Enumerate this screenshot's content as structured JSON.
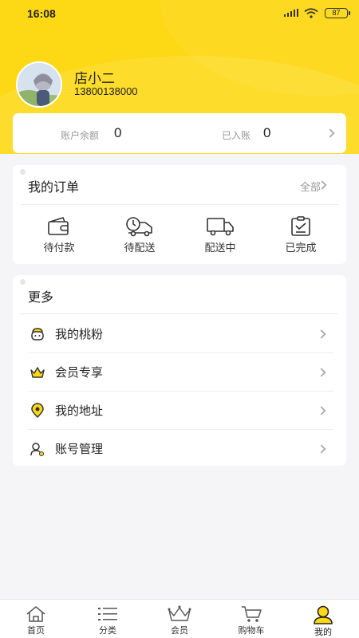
{
  "status_bar": {
    "time": "16:08",
    "battery": "87"
  },
  "profile": {
    "name": "店小二",
    "phone": "13800138000"
  },
  "account": {
    "balance_label": "账户余额",
    "balance_value": "0",
    "settled_label": "已入账",
    "settled_value": "0"
  },
  "orders": {
    "title": "我的订单",
    "all_label": "全部",
    "items": [
      {
        "label": "待付款",
        "icon": "wallet-icon"
      },
      {
        "label": "待配送",
        "icon": "delivery-clock-icon"
      },
      {
        "label": "配送中",
        "icon": "truck-icon"
      },
      {
        "label": "已完成",
        "icon": "checklist-icon"
      }
    ]
  },
  "more": {
    "title": "更多",
    "items": [
      {
        "label": "我的桃粉",
        "icon": "fans-icon"
      },
      {
        "label": "会员专享",
        "icon": "crown-icon"
      },
      {
        "label": "我的地址",
        "icon": "location-pin-icon"
      },
      {
        "label": "账号管理",
        "icon": "account-manage-icon"
      }
    ]
  },
  "tabbar": {
    "items": [
      {
        "label": "首页",
        "icon": "home-icon"
      },
      {
        "label": "分类",
        "icon": "list-icon"
      },
      {
        "label": "会员",
        "icon": "crown-icon"
      },
      {
        "label": "购物车",
        "icon": "cart-icon"
      },
      {
        "label": "我的",
        "icon": "user-icon",
        "active": true
      }
    ]
  },
  "colors": {
    "brand": "#fdd814",
    "text": "#222222",
    "muted": "#999999"
  }
}
